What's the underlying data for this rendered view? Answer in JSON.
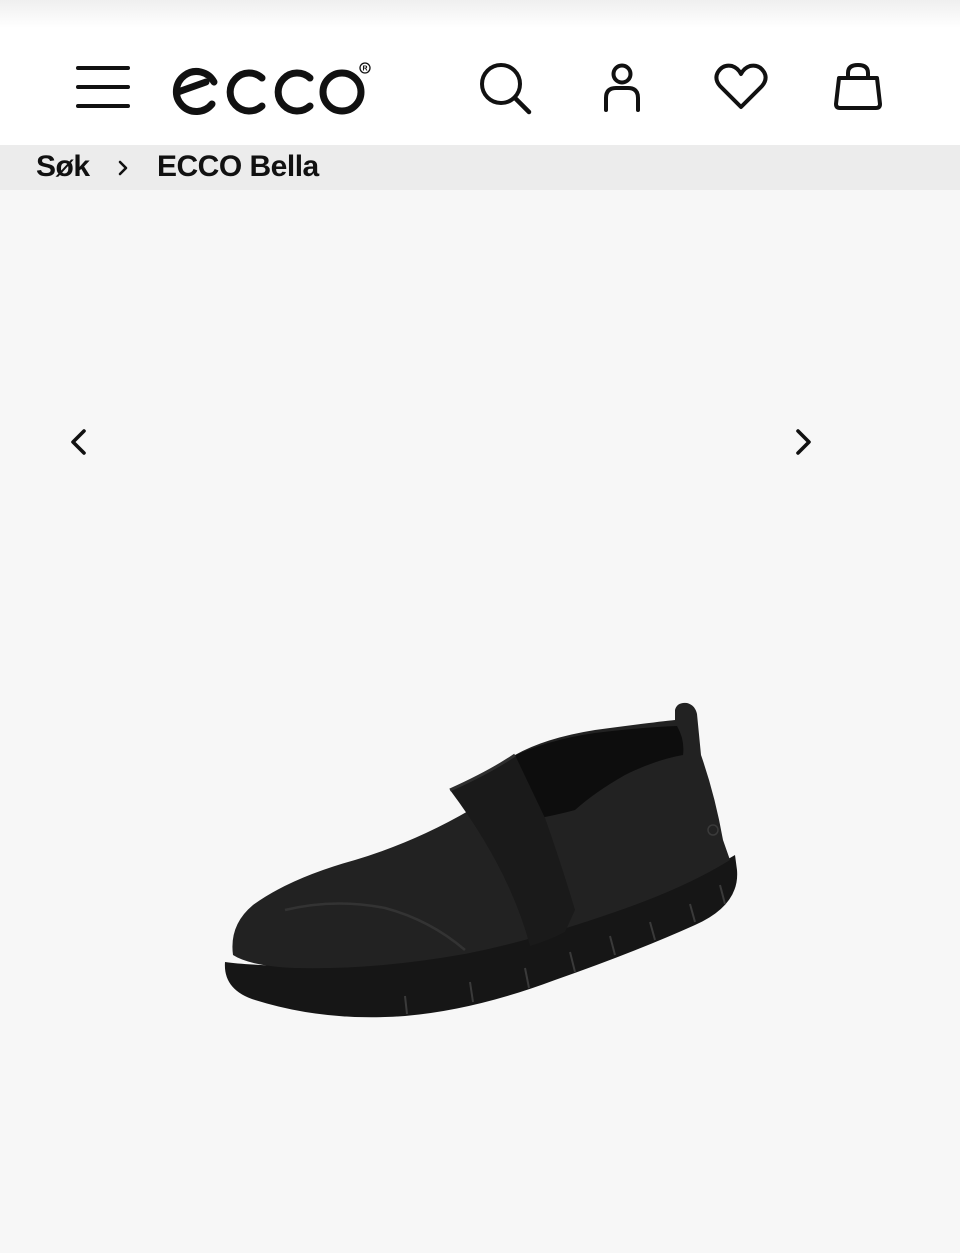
{
  "header": {
    "menu_icon": "hamburger-menu-icon",
    "logo_text": "ecco",
    "search_icon": "search-icon",
    "account_icon": "user-icon",
    "wishlist_icon": "heart-icon",
    "bag_icon": "shopping-bag-icon"
  },
  "breadcrumb": {
    "items": [
      {
        "label": "Søk"
      },
      {
        "label": "ECCO Bella"
      }
    ],
    "separator_icon": "chevron-right-icon"
  },
  "gallery": {
    "prev_icon": "chevron-left-icon",
    "next_icon": "chevron-right-icon",
    "image_alt": "black-slip-on-loafer"
  },
  "colors": {
    "background": "#f7f7f7",
    "header_bg": "#ffffff",
    "breadcrumb_bg": "#ececec",
    "text": "#111111",
    "shoe": "#1c1c1c"
  }
}
